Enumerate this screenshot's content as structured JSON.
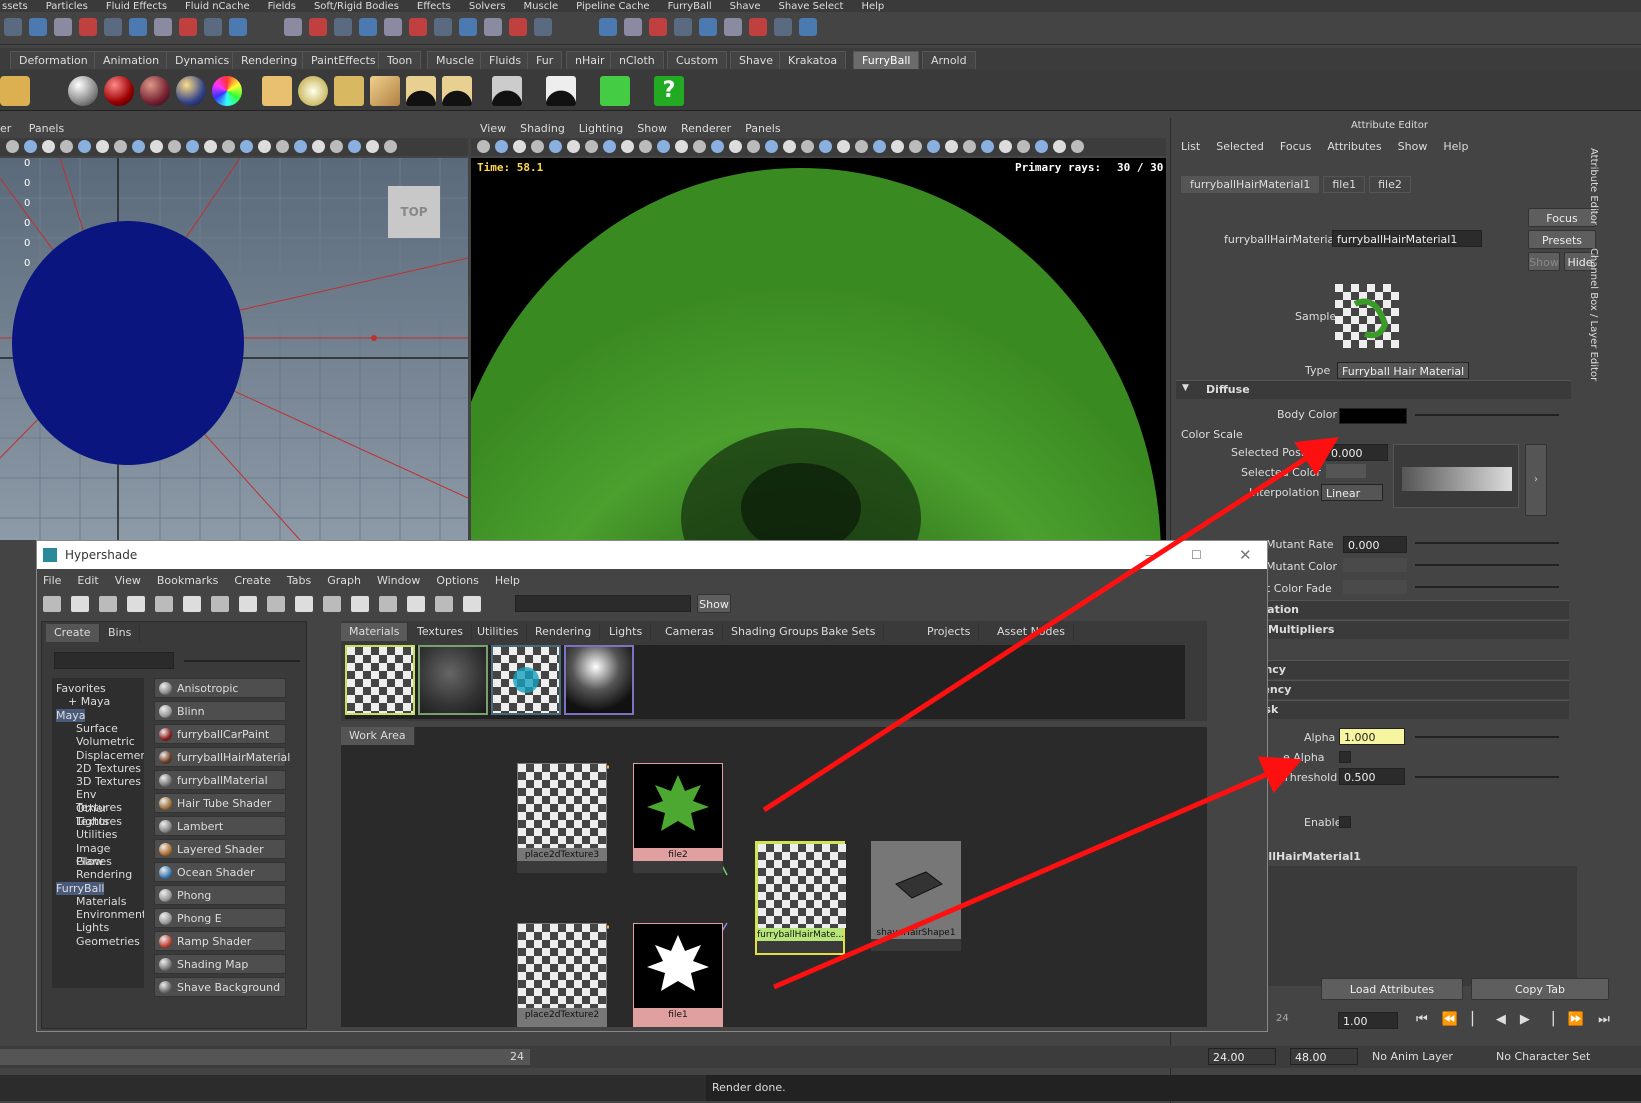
{
  "menubar": [
    "ssets",
    "Particles",
    "Fluid Effects",
    "Fluid nCache",
    "Fields",
    "Soft/Rigid Bodies",
    "Effects",
    "Solvers",
    "Muscle",
    "Pipeline Cache",
    "FurryBall",
    "Shave",
    "Shave Select",
    "Help"
  ],
  "shelf_tabs": [
    "Deformation",
    "Animation",
    "Dynamics",
    "Rendering",
    "PaintEffects",
    "Toon",
    "Muscle",
    "Fluids",
    "Fur",
    "nHair",
    "nCloth",
    "Custom",
    "Shave",
    "Krakatoa",
    "FurryBall",
    "Arnold"
  ],
  "shelf_active": "FurryBall",
  "left_viewport": {
    "menu": [
      "er",
      "Panels"
    ],
    "tick_labels": [
      "0",
      "0",
      "0",
      "0",
      "0",
      "0"
    ],
    "view_cube": "TOP"
  },
  "render_view": {
    "menu": [
      "View",
      "Shading",
      "Lighting",
      "Show",
      "Renderer",
      "Panels"
    ],
    "time": "Time: 58.1",
    "rays_label": "Primary rays:",
    "rays_value": "30 / 30"
  },
  "attr_editor": {
    "title": "Attribute Editor",
    "menu": [
      "List",
      "Selected",
      "Focus",
      "Attributes",
      "Show",
      "Help"
    ],
    "tabs": [
      "furryballHairMaterial1",
      "file1",
      "file2"
    ],
    "node_label": "furryballHairMaterial:",
    "node_value": "furryballHairMaterial1",
    "focus": "Focus",
    "presets": "Presets",
    "show": "Show",
    "hide": "Hide",
    "sample": "Sample",
    "type_label": "Type",
    "type_value": "Furryball Hair Material",
    "diffuse": "Diffuse",
    "body_color": "Body Color",
    "color_scale": "Color Scale",
    "selected_position": "Selected Positi",
    "selected_position_value": "0.000",
    "selected_color": "Selected Color",
    "interpolation": "Interpolation",
    "interpolation_value": "Linear",
    "mutant_rate": "Mutant Rate",
    "mutant_rate_value": "0.000",
    "mutant_color": "Mutant Color",
    "mutant_color_fade": "nt Color Fade",
    "sec_ization": "ization",
    "sec_multipliers": "y Multipliers",
    "sec_ency": "ency",
    "sec_rency": "rency",
    "sec_ask": "ask",
    "alpha": "Alpha",
    "alpha_value": "1.000",
    "use_alpha": "e Alpha",
    "threshold": "Threshold",
    "threshold_value": "0.500",
    "enable": "Enable",
    "node_footer": "allHairMaterial1",
    "load_attributes": "Load Attributes",
    "copy_tab": "Copy Tab",
    "side_tabs": [
      "Attribute Editor",
      "Channel Box / Layer Editor"
    ]
  },
  "hypershade": {
    "title": "Hypershade",
    "menu": [
      "File",
      "Edit",
      "View",
      "Bookmarks",
      "Create",
      "Tabs",
      "Graph",
      "Window",
      "Options",
      "Help"
    ],
    "show_button": "Show",
    "left_tabs": [
      "Create",
      "Bins"
    ],
    "tree": [
      "Favorites",
      "+ Maya",
      "Maya",
      "Surface",
      "Volumetric",
      "Displacement",
      "2D Textures",
      "3D Textures",
      "Env Textures",
      "Other Textures",
      "Lights",
      "Utilities",
      "Image Planes",
      "Glow",
      "Rendering",
      "FurryBall",
      "Materials",
      "Environments",
      "Lights",
      "Geometries"
    ],
    "shaders": [
      {
        "name": "Anisotropic",
        "color": "#888"
      },
      {
        "name": "Blinn",
        "color": "#999"
      },
      {
        "name": "furryballCarPaint",
        "color": "#8a1a1a"
      },
      {
        "name": "furryballHairMaterial",
        "color": "#6b3a20"
      },
      {
        "name": "furryballMaterial",
        "color": "#777"
      },
      {
        "name": "Hair Tube Shader",
        "color": "#a0703a"
      },
      {
        "name": "Lambert",
        "color": "#888"
      },
      {
        "name": "Layered Shader",
        "color": "#b07030"
      },
      {
        "name": "Ocean Shader",
        "color": "#3a7ab0"
      },
      {
        "name": "Phong",
        "color": "#999"
      },
      {
        "name": "Phong E",
        "color": "#999"
      },
      {
        "name": "Ramp Shader",
        "color": "#c04030"
      },
      {
        "name": "Shading Map",
        "color": "#777"
      },
      {
        "name": "Shave Background",
        "color": "#666"
      }
    ],
    "tabs": [
      "Materials",
      "Textures",
      "Utilities",
      "Rendering",
      "Lights",
      "Cameras",
      "Shading Groups",
      "Bake Sets",
      "Projects",
      "Asset Nodes"
    ],
    "work_area": "Work Area",
    "nodes": [
      {
        "name": "place2dTexture3",
        "kind": "place"
      },
      {
        "name": "file2",
        "kind": "leaf-green"
      },
      {
        "name": "furryballHairMate...",
        "kind": "checker-leaf"
      },
      {
        "name": "shaveHairShape1",
        "kind": "shape"
      },
      {
        "name": "place2dTexture2",
        "kind": "place"
      },
      {
        "name": "file1",
        "kind": "leaf-white"
      }
    ]
  },
  "timeline": {
    "frame": "24",
    "start": "24.00",
    "end": "48.00",
    "anim_layer": "No Anim Layer",
    "char_set": "No Character Set",
    "current": "1.00",
    "range_end": "24"
  },
  "status": "Render done.",
  "colors": {
    "annotation": "#ff1010",
    "highlight": "#f6f6a0",
    "selected_node": "#b6e67a",
    "file_node": "#e0a0a0"
  }
}
